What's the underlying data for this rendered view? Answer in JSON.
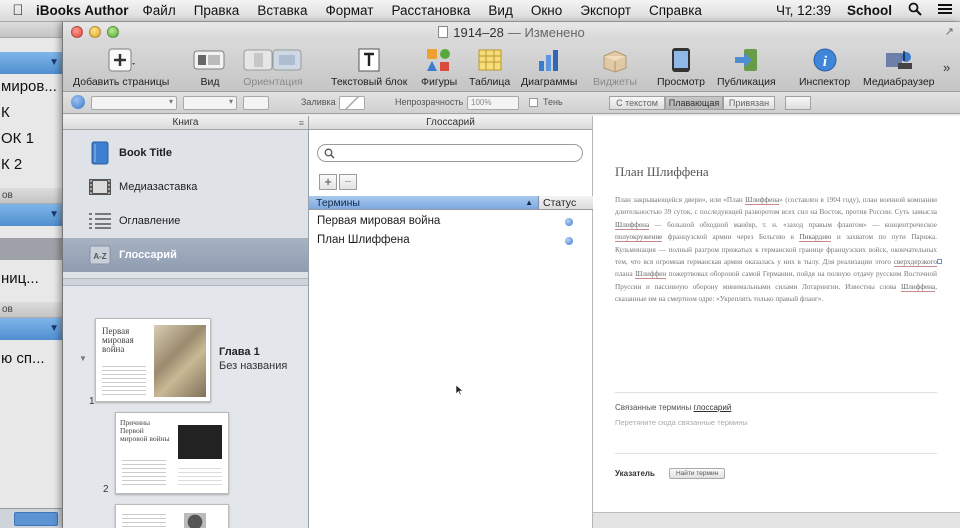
{
  "menubar": {
    "app": "iBooks Author",
    "items": [
      "Файл",
      "Правка",
      "Вставка",
      "Формат",
      "Расстановка",
      "Вид",
      "Окно",
      "Экспорт",
      "Справка"
    ],
    "clock": "Чт, 12:39",
    "user": "School"
  },
  "background_window": {
    "items": [
      "миров...",
      "К",
      "ОК 1",
      "К 2",
      "ов",
      "ниц...",
      "ов",
      "ю сп..."
    ]
  },
  "window": {
    "title": "1914–28",
    "status": "— Изменено"
  },
  "toolbar": {
    "add_pages": "Добавить страницы",
    "view": "Вид",
    "orientation": "Ориентация",
    "textbox": "Текстовый блок",
    "shapes": "Фигуры",
    "table": "Таблица",
    "charts": "Диаграммы",
    "widgets": "Виджеты",
    "preview": "Просмотр",
    "publish": "Публикация",
    "inspector": "Инспектор",
    "media": "Медиабраузер"
  },
  "formatbar": {
    "fill": "Заливка",
    "opacity": "Непрозрачность",
    "opacity_value": "100%",
    "shadow": "Тень",
    "wrap": [
      "С текстом",
      "Плавающая",
      "Привязан"
    ]
  },
  "book_pane": {
    "header": "Книга",
    "items": [
      {
        "label": "Book Title",
        "icon": "book-icon"
      },
      {
        "label": "Медиазаставка",
        "icon": "film-icon"
      },
      {
        "label": "Оглавление",
        "icon": "list-icon"
      },
      {
        "label": "Глоссарий",
        "icon": "az-icon"
      }
    ],
    "chapter": {
      "title": "Глава 1",
      "subtitle": "Без названия"
    },
    "thumb1_title": "Первая мировая война",
    "thumb2_title": "Причины Первой мировой войны",
    "page_numbers": [
      "1",
      "2"
    ]
  },
  "glossary": {
    "header": "Глоссарий",
    "col_terms": "Термины",
    "col_status": "Статус",
    "add": "+",
    "remove": "−",
    "terms": [
      "Первая мировая война",
      "План Шлиффена"
    ]
  },
  "definition": {
    "title": "План Шлиффена",
    "text": [
      {
        "t": "План закрывающейся двери», или «План "
      },
      {
        "t": "Шлиффена",
        "u": true
      },
      {
        "t": "» (составлен в 1904 году), план военной компании длительностью 39 суток, с последующей разворотом всех сил на Восток, против России. Суть замысла "
      },
      {
        "t": "Шлиффена",
        "u": true
      },
      {
        "t": " — большой обходной манёвр, т. н. «заход правым флангом» — концентрическое "
      },
      {
        "t": "полуокружение",
        "u": true
      },
      {
        "t": " французской армии через Бельгию в "
      },
      {
        "t": "Пикардию",
        "u": true
      },
      {
        "t": " и захватом по пути Парижа. Кульминация — полный разгром прижатых к германской границе французских войск, окончательных тем, что вся огромная германская армия оказалась у них в тылу. Для реализации этого "
      },
      {
        "t": "сверхдерзкого",
        "u": true
      },
      {
        "t": " плана "
      },
      {
        "t": "Шлиффен",
        "u": true
      },
      {
        "t": " пожертвовал обороной самой Германии, пойдя на полную отдачу русским Восточной Пруссии и пассивную оборону минимальными силами Лотарингии. Известны слова "
      },
      {
        "t": "Шлиффена",
        "u": true
      },
      {
        "t": ", сказанные им на смертном одре: «Укреплять только правый фланг»."
      }
    ],
    "related_label": "Связанные термины",
    "related_link": "глоссарий",
    "related_hint": "Перетяните сюда связанные термины",
    "index_label": "Указатель",
    "index_button": "Найти термин"
  },
  "colors": {
    "accent": "#7da9e0",
    "selection": "#8f9cb1"
  }
}
